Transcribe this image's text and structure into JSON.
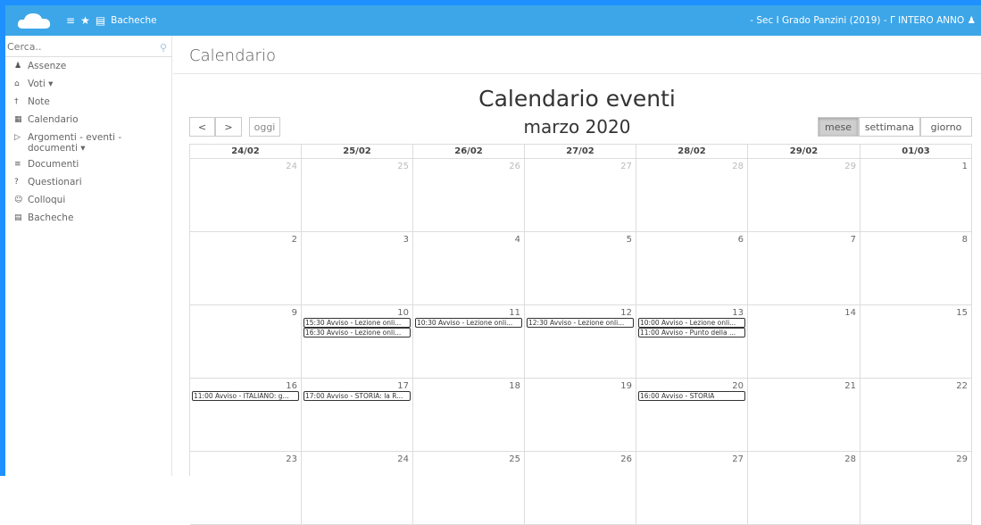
{
  "topbar": {
    "nav_label": "Bacheche",
    "context": "- Sec I Grado Panzini (2019) - Γ  INTERO ANNO"
  },
  "sidebar": {
    "search_placeholder": "Cerca..",
    "items": [
      {
        "label": "Assenze",
        "icon": "user-icon"
      },
      {
        "label": "Voti ▾",
        "icon": "bank-icon"
      },
      {
        "label": "Note",
        "icon": "pin-icon"
      },
      {
        "label": "Calendario",
        "icon": "calendar-icon"
      },
      {
        "label": "Argomenti - eventi - documenti ▾",
        "icon": "folder-icon"
      },
      {
        "label": "Documenti",
        "icon": "graduation-icon"
      },
      {
        "label": "Questionari",
        "icon": "question-icon"
      },
      {
        "label": "Colloqui",
        "icon": "chat-icon"
      },
      {
        "label": "Bacheche",
        "icon": "board-icon"
      }
    ]
  },
  "main": {
    "page_title": "Calendario",
    "calendar_title": "Calendario eventi",
    "month": "marzo 2020",
    "buttons": {
      "prev": "<",
      "next": ">",
      "today": "oggi",
      "month": "mese",
      "week": "settimana",
      "day": "giorno"
    },
    "headers": [
      "24/02",
      "25/02",
      "26/02",
      "27/02",
      "28/02",
      "29/02",
      "01/03"
    ],
    "weeks": [
      {
        "days": [
          {
            "n": "24",
            "other": true
          },
          {
            "n": "25",
            "other": true
          },
          {
            "n": "26",
            "other": true
          },
          {
            "n": "27",
            "other": true
          },
          {
            "n": "28",
            "other": true
          },
          {
            "n": "29",
            "other": true
          },
          {
            "n": "1",
            "other": false
          }
        ],
        "events": []
      },
      {
        "days": [
          {
            "n": "2",
            "other": false
          },
          {
            "n": "3",
            "other": false
          },
          {
            "n": "4",
            "other": false
          },
          {
            "n": "5",
            "other": false
          },
          {
            "n": "6",
            "other": false
          },
          {
            "n": "7",
            "other": false
          },
          {
            "n": "8",
            "other": false
          }
        ],
        "events": []
      },
      {
        "days": [
          {
            "n": "9",
            "other": false
          },
          {
            "n": "10",
            "other": false
          },
          {
            "n": "11",
            "other": false
          },
          {
            "n": "12",
            "other": false
          },
          {
            "n": "13",
            "other": false
          },
          {
            "n": "14",
            "other": false
          },
          {
            "n": "15",
            "other": false
          }
        ],
        "events": [
          {
            "day": 1,
            "slot": 0,
            "text": "15:30 Avviso - Lezione onli..."
          },
          {
            "day": 1,
            "slot": 1,
            "text": "16:30 Avviso - Lezione onli..."
          },
          {
            "day": 2,
            "slot": 0,
            "text": "10:30 Avviso - Lezione onli..."
          },
          {
            "day": 3,
            "slot": 0,
            "text": "12:30 Avviso - Lezione onli..."
          },
          {
            "day": 4,
            "slot": 0,
            "text": "10:00 Avviso - Lezione onli..."
          },
          {
            "day": 4,
            "slot": 1,
            "text": "11:00 Avviso - Punto della ..."
          }
        ]
      },
      {
        "days": [
          {
            "n": "16",
            "other": false
          },
          {
            "n": "17",
            "other": false
          },
          {
            "n": "18",
            "other": false
          },
          {
            "n": "19",
            "other": false
          },
          {
            "n": "20",
            "other": false
          },
          {
            "n": "21",
            "other": false
          },
          {
            "n": "22",
            "other": false
          }
        ],
        "events": [
          {
            "day": 0,
            "slot": 0,
            "text": "11:00 Avviso - ITALIANO: g..."
          },
          {
            "day": 1,
            "slot": 0,
            "text": "17:00 Avviso - STORIA: la R..."
          },
          {
            "day": 4,
            "slot": 0,
            "text": "16:00 Avviso - STORIA"
          }
        ]
      },
      {
        "days": [
          {
            "n": "23",
            "other": false
          },
          {
            "n": "24",
            "other": false
          },
          {
            "n": "25",
            "other": false
          },
          {
            "n": "26",
            "other": false
          },
          {
            "n": "27",
            "other": false
          },
          {
            "n": "28",
            "other": false
          },
          {
            "n": "29",
            "other": false
          }
        ],
        "events": []
      }
    ]
  }
}
